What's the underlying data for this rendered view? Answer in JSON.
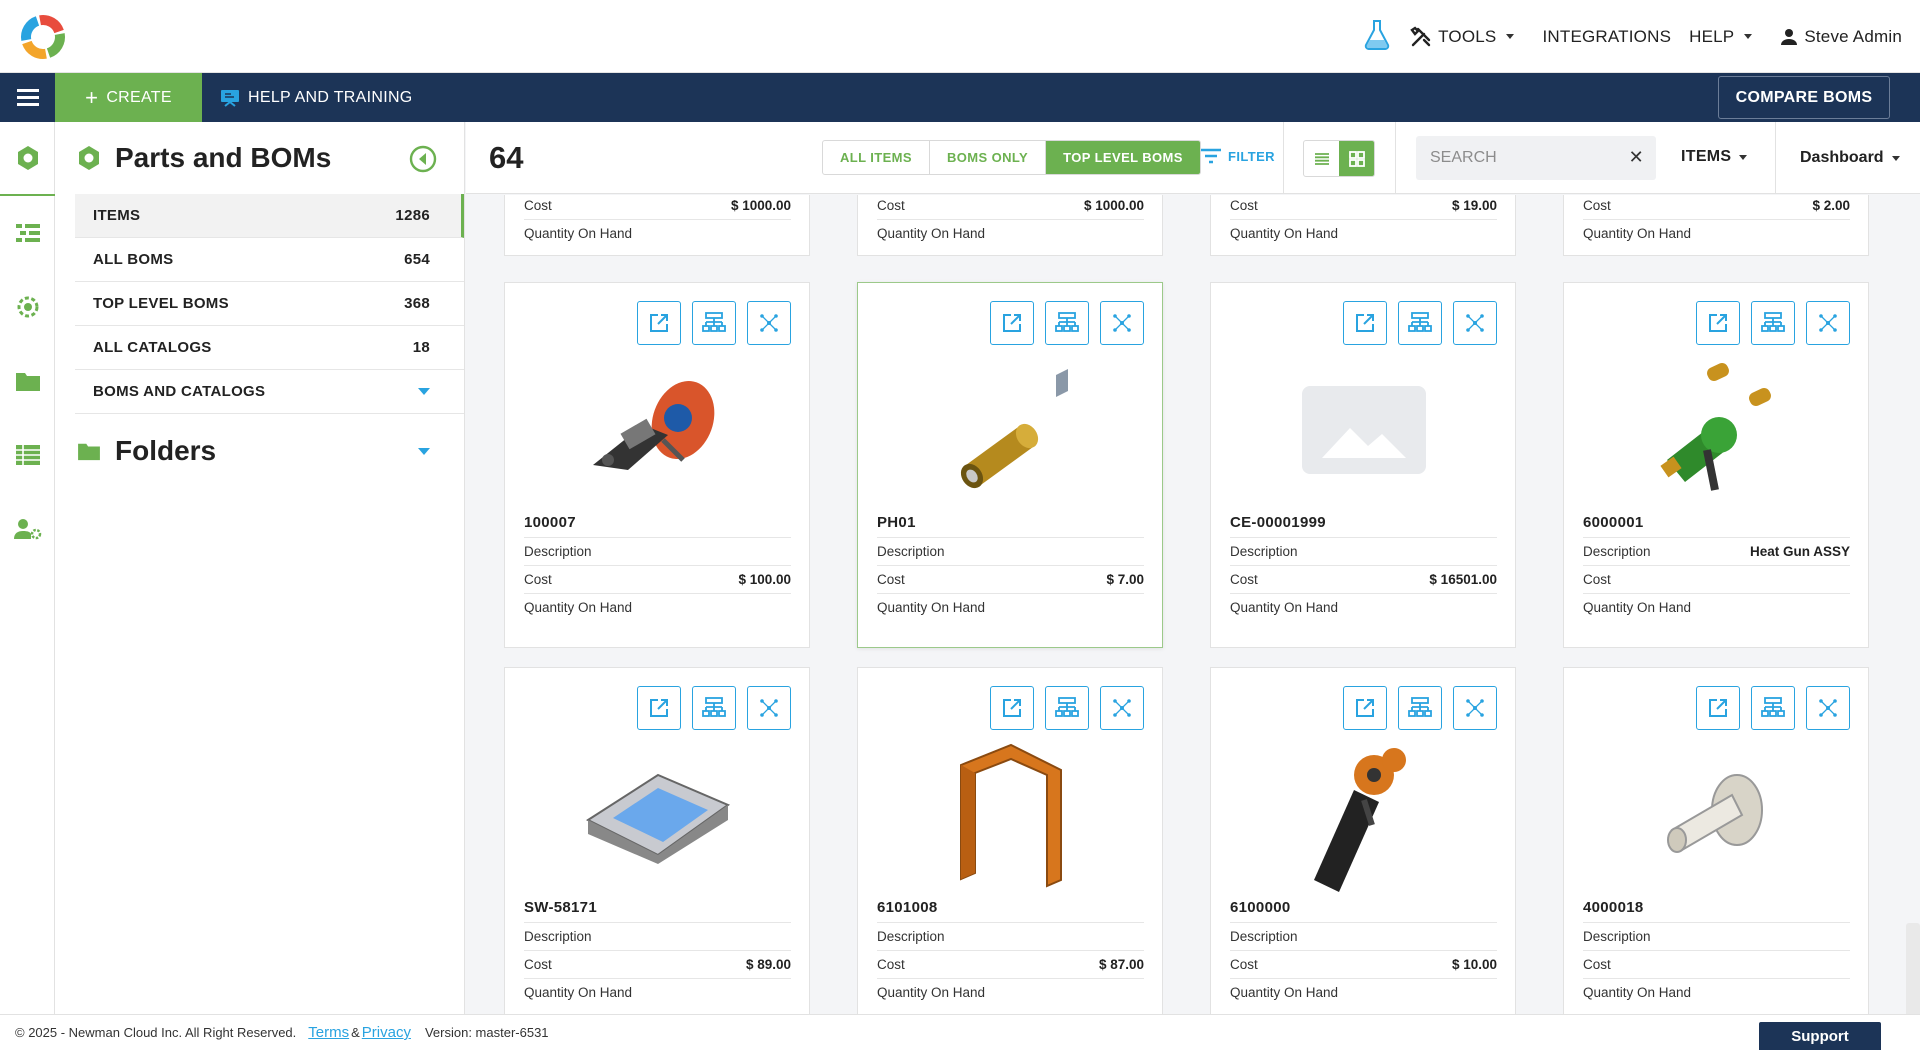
{
  "header": {
    "nav": {
      "tools": "TOOLS",
      "integrations": "INTEGRATIONS",
      "help": "HELP",
      "user": "Steve Admin"
    }
  },
  "navbar": {
    "create": "CREATE",
    "help_training": "HELP AND TRAINING",
    "compare": "COMPARE BOMS"
  },
  "sidebar": {
    "title": "Parts and BOMs",
    "items": [
      {
        "label": "ITEMS",
        "count": "1286"
      },
      {
        "label": "ALL BOMS",
        "count": "654"
      },
      {
        "label": "TOP LEVEL BOMS",
        "count": "368"
      },
      {
        "label": "ALL CATALOGS",
        "count": "18"
      },
      {
        "label": "BOMS AND CATALOGS",
        "count": ""
      }
    ],
    "folders": "Folders"
  },
  "toolbar": {
    "count": "64",
    "segments": [
      "ALL ITEMS",
      "BOMS ONLY",
      "TOP LEVEL BOMS"
    ],
    "filter": "FILTER",
    "search_placeholder": "SEARCH",
    "items_dd": "ITEMS",
    "dashboard_dd": "Dashboard"
  },
  "labels": {
    "cost": "Cost",
    "description": "Description",
    "qoh": "Quantity On Hand"
  },
  "partial_cards": [
    {
      "cost": "$ 1000.00"
    },
    {
      "cost": "$ 1000.00"
    },
    {
      "cost": "$ 19.00"
    },
    {
      "cost": "$ 2.00"
    }
  ],
  "cards": [
    {
      "pn": "100007",
      "description": "",
      "cost": "$ 100.00",
      "qoh": "",
      "image": "motor-assembly"
    },
    {
      "pn": "PH01",
      "description": "",
      "cost": "$ 7.00",
      "qoh": "",
      "image": "brass-cylinder"
    },
    {
      "pn": "CE-00001999",
      "description": "",
      "cost": "$ 16501.00",
      "qoh": "",
      "image": "placeholder"
    },
    {
      "pn": "6000001",
      "description": "Heat Gun ASSY",
      "cost": "",
      "qoh": "",
      "image": "heat-gun"
    },
    {
      "pn": "SW-58171",
      "description": "",
      "cost": "$ 89.00",
      "qoh": "",
      "image": "handheld-device"
    },
    {
      "pn": "6101008",
      "description": "",
      "cost": "$ 87.00",
      "qoh": "",
      "image": "sheet-bracket"
    },
    {
      "pn": "6100000",
      "description": "",
      "cost": "$ 10.00",
      "qoh": "",
      "image": "gun-handle"
    },
    {
      "pn": "4000018",
      "description": "",
      "cost": "",
      "qoh": "",
      "image": "pulley-shaft"
    }
  ],
  "footer": {
    "copyright": "© 2025 - Newman Cloud Inc. All Right Reserved.",
    "terms": "Terms",
    "amp": "&",
    "privacy": "Privacy",
    "version": "Version: master-6531",
    "support": "Support"
  },
  "colors": {
    "navy": "#1c3457",
    "green": "#6cb150",
    "blue": "#29a3e0"
  }
}
